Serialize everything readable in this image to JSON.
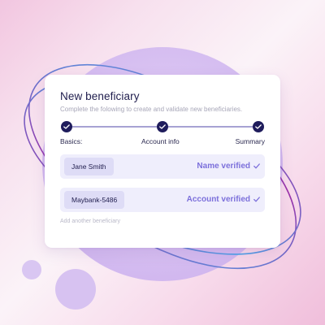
{
  "form": {
    "title": "New beneficiary",
    "subtitle": "Complete the folowing to create and validate new beneficiaries."
  },
  "steps": [
    {
      "label": "Basics:",
      "completed": true
    },
    {
      "label": "Account info",
      "completed": true
    },
    {
      "label": "Summary",
      "completed": true
    }
  ],
  "rows": [
    {
      "value": "Jane Smith",
      "status": "Name verified",
      "status_icon": "check-icon"
    },
    {
      "value": "Maybank-5486",
      "status": "Account verified",
      "status_icon": "check-icon"
    }
  ],
  "add_link": "Add another beneficiary",
  "colors": {
    "accent": "#7c70db",
    "step_dot": "#1f1c5c",
    "title": "#1f1d4d",
    "row_bg": "#efeefc",
    "chip_bg": "#dedcf6",
    "orbit_purple": "#9b2fa8",
    "orbit_blue": "#4aa3e8"
  }
}
